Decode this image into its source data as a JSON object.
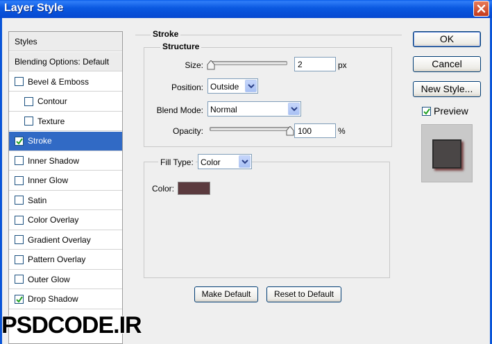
{
  "window": {
    "title": "Layer Style"
  },
  "styles": {
    "header": "Styles",
    "blending": "Blending Options: Default",
    "items": [
      {
        "label": "Bevel & Emboss",
        "checked": false,
        "indent": false
      },
      {
        "label": "Contour",
        "checked": false,
        "indent": true
      },
      {
        "label": "Texture",
        "checked": false,
        "indent": true
      },
      {
        "label": "Stroke",
        "checked": true,
        "indent": false,
        "selected": true
      },
      {
        "label": "Inner Shadow",
        "checked": false,
        "indent": false
      },
      {
        "label": "Inner Glow",
        "checked": false,
        "indent": false
      },
      {
        "label": "Satin",
        "checked": false,
        "indent": false
      },
      {
        "label": "Color Overlay",
        "checked": false,
        "indent": false
      },
      {
        "label": "Gradient Overlay",
        "checked": false,
        "indent": false
      },
      {
        "label": "Pattern Overlay",
        "checked": false,
        "indent": false
      },
      {
        "label": "Outer Glow",
        "checked": false,
        "indent": false
      },
      {
        "label": "Drop Shadow",
        "checked": true,
        "indent": false
      }
    ]
  },
  "stroke": {
    "section_title": "Stroke",
    "structure_title": "Structure",
    "size_label": "Size:",
    "size_value": "2",
    "size_unit": "px",
    "size_fraction": 0.0,
    "position_label": "Position:",
    "position_value": "Outside",
    "blend_label": "Blend Mode:",
    "blend_value": "Normal",
    "opacity_label": "Opacity:",
    "opacity_value": "100",
    "opacity_unit": "%",
    "opacity_fraction": 1.0,
    "fill_type_label": "Fill Type:",
    "fill_type_value": "Color",
    "color_label": "Color:",
    "color_swatch": "#5b3a3e"
  },
  "buttons": {
    "make_default": "Make Default",
    "reset_default": "Reset to Default",
    "ok": "OK",
    "cancel": "Cancel",
    "new_style": "New Style...",
    "preview": "Preview"
  },
  "watermark": {
    "text": "PSDCODE.IR"
  }
}
